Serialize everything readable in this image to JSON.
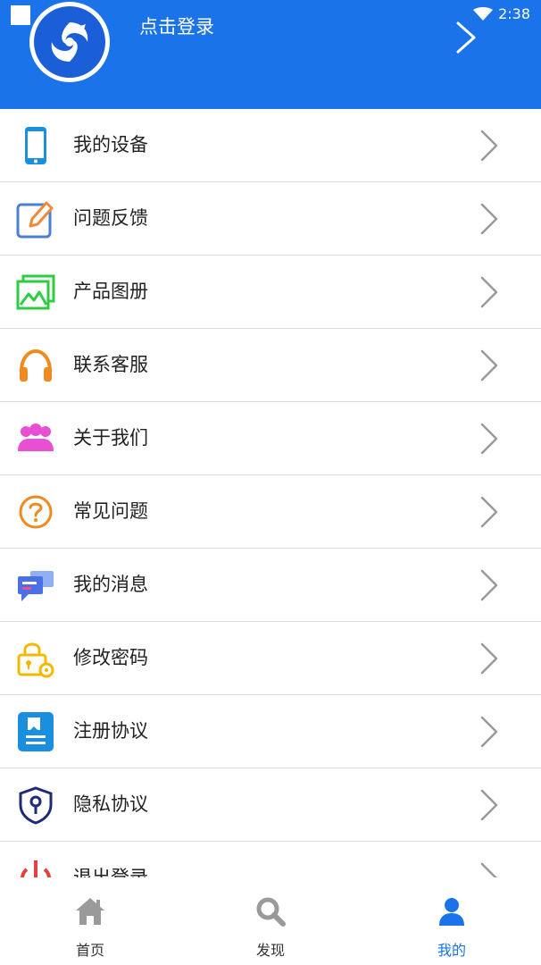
{
  "header": {
    "login_text": "点击登录",
    "time": "2:38",
    "bg_color": "#1a73e8"
  },
  "menu": {
    "items": [
      {
        "label": "我的设备",
        "icon": "phone-icon"
      },
      {
        "label": "问题反馈",
        "icon": "edit-icon"
      },
      {
        "label": "产品图册",
        "icon": "gallery-icon"
      },
      {
        "label": "联系客服",
        "icon": "headphones-icon"
      },
      {
        "label": "关于我们",
        "icon": "users-icon"
      },
      {
        "label": "常见问题",
        "icon": "help-icon"
      },
      {
        "label": "我的消息",
        "icon": "chat-icon"
      },
      {
        "label": "修改密码",
        "icon": "lock-gear-icon"
      },
      {
        "label": "注册协议",
        "icon": "document-icon"
      },
      {
        "label": "隐私协议",
        "icon": "shield-keyhole-icon"
      },
      {
        "label": "退出登录",
        "icon": "logout-icon"
      }
    ]
  },
  "tabs": [
    {
      "label": "首页",
      "icon": "home-icon"
    },
    {
      "label": "发现",
      "icon": "search-icon"
    },
    {
      "label": "我的",
      "icon": "person-icon",
      "active": true
    }
  ],
  "colors": {
    "accent": "#1a73e8",
    "divider": "#dcdcdc",
    "chevron": "#999999"
  }
}
